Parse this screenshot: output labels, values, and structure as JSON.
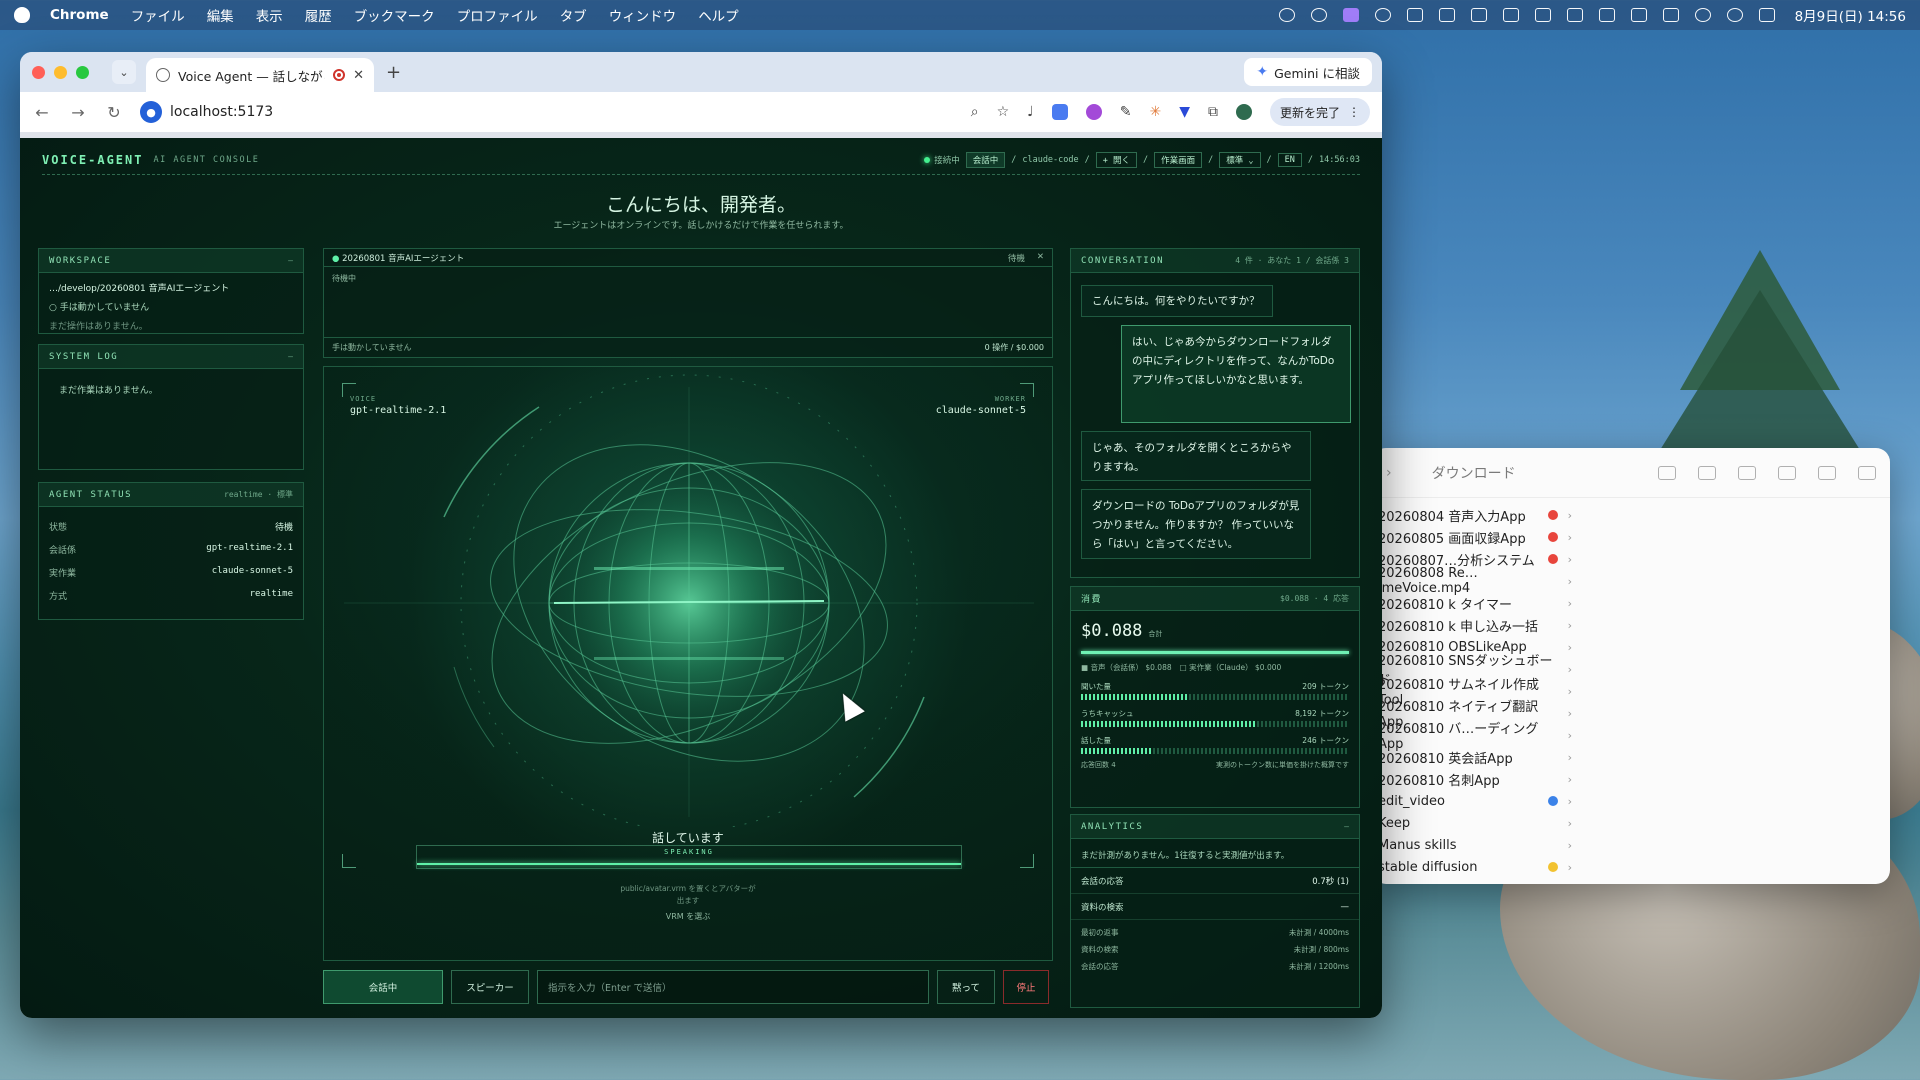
{
  "menubar": {
    "app": "Chrome",
    "items": [
      "ファイル",
      "編集",
      "表示",
      "履歴",
      "ブックマーク",
      "プロファイル",
      "タブ",
      "ウィンドウ",
      "ヘルプ"
    ],
    "clock": "8月9日(日) 14:56"
  },
  "browser": {
    "tab_title": "Voice Agent — 話しながら",
    "gemini_label": "Gemini に相談",
    "url": "localhost:5173",
    "update_label": "更新を完了"
  },
  "app": {
    "brand": "VOICE-AGENT",
    "brand_sub": "AI AGENT CONSOLE",
    "status": {
      "connected": "接続中",
      "in_conversation": "会話中",
      "engine": "claude-code",
      "open": "+ 開く",
      "work_screen": "作業画面",
      "mode": "標準",
      "lang": "EN",
      "time": "14:56:03"
    },
    "greeting": "こんにちは、開発者。",
    "greeting_sub": "エージェントはオンラインです。話しかけるだけで作業を任せられます。"
  },
  "workspace": {
    "title": "WORKSPACE",
    "path": "…/develop/20260801 音声AIエージェント",
    "hands": "手は動かしていません",
    "no_ops": "まだ操作はありません。"
  },
  "system_log": {
    "title": "SYSTEM LOG",
    "empty": "まだ作業はありません。"
  },
  "agent_status": {
    "title": "AGENT STATUS",
    "aux": "realtime · 標準",
    "rows": [
      {
        "k": "状態",
        "v": "待機"
      },
      {
        "k": "会話係",
        "v": "gpt-realtime-2.1"
      },
      {
        "k": "実作業",
        "v": "claude-sonnet-5"
      },
      {
        "k": "方式",
        "v": "realtime"
      }
    ]
  },
  "task": {
    "title": "20260801 音声AIエージェント",
    "state": "待機",
    "body": "待機中",
    "foot_left": "手は動かしていません",
    "foot_right": "0 操作 / $0.000"
  },
  "stage": {
    "voice_label": "VOICE",
    "voice_model": "gpt-realtime-2.1",
    "worker_label": "WORKER",
    "worker_model": "claude-sonnet-5",
    "speaking": "話しています",
    "speaking_tag": "SPEAKING",
    "hint_line1": "public/avatar.vrm を置くとアバターが",
    "hint_line2": "出ます",
    "vrm": "VRM を選ぶ"
  },
  "controls": {
    "talk": "会話中",
    "speaker": "スピーカー",
    "input_placeholder": "指示を入力（Enter で送信）",
    "silence": "黙って",
    "stop": "停止"
  },
  "conversation": {
    "title": "CONVERSATION",
    "aux": "4 件 · あなた 1 / 会話係 3",
    "messages": [
      {
        "role": "agent",
        "text": "こんにちは。何をやりたいですか？"
      },
      {
        "role": "user",
        "text": "はい、じゃあ今からダウンロードフォルダの中にディレクトリを作って、なんかToDoアプリ作ってほしいかなと思います。"
      },
      {
        "role": "agent",
        "text": "じゃあ、そのフォルダを開くところからやりますね。"
      },
      {
        "role": "agent",
        "text": "ダウンロードの ToDoアプリのフォルダが見つかりません。作りますか？ 作っていいなら「はい」と言ってください。"
      }
    ]
  },
  "cost": {
    "title": "消費",
    "aux": "$0.088 · 4 応答",
    "total": "$0.088",
    "total_label": "合計",
    "legend_voice": "音声（会話係） $0.088",
    "legend_worker": "実作業（Claude） $0.000",
    "tokens": [
      {
        "label": "聞いた量",
        "value": "209 トークン",
        "fill": 0.4
      },
      {
        "label": "うちキャッシュ",
        "value": "8,192 トークン",
        "fill": 0.65
      },
      {
        "label": "話した量",
        "value": "246 トークン",
        "fill": 0.27
      }
    ],
    "responses": "応答回数 4",
    "note": "実測のトークン数に単価を掛けた概算です"
  },
  "analytics": {
    "title": "ANALYTICS",
    "note": "まだ計測がありません。1往復すると実測値が出ます。",
    "rows": [
      {
        "k": "会話の応答",
        "v": "0.7秒  (1)"
      },
      {
        "k": "資料の検索",
        "v": "—"
      }
    ],
    "sub_rows": [
      {
        "k": "最初の返事",
        "v": "未計測 / 4000ms"
      },
      {
        "k": "資料の検索",
        "v": "未計測 / 800ms"
      },
      {
        "k": "会話の応答",
        "v": "未計測 / 1200ms"
      }
    ]
  },
  "finder": {
    "title": "ダウンロード",
    "items": [
      {
        "name": "20260804 音声入力App",
        "tag": "#e8453c"
      },
      {
        "name": "20260805 画面収録App",
        "tag": "#e8453c"
      },
      {
        "name": "20260807…分析システム",
        "tag": "#e8453c"
      },
      {
        "name": "20260808 Re…imeVoice.mp4",
        "tag": ""
      },
      {
        "name": "20260810 k タイマー",
        "tag": ""
      },
      {
        "name": "20260810 k 申し込み一括",
        "tag": ""
      },
      {
        "name": "20260810 OBSLikeApp",
        "tag": ""
      },
      {
        "name": "20260810 SNSダッシュボード",
        "tag": ""
      },
      {
        "name": "20260810 サムネイル作成Tool",
        "tag": ""
      },
      {
        "name": "20260810 ネイティブ翻訳App",
        "tag": ""
      },
      {
        "name": "20260810 バ…ーディングApp",
        "tag": ""
      },
      {
        "name": "20260810 英会話App",
        "tag": ""
      },
      {
        "name": "20260810 名刺App",
        "tag": ""
      },
      {
        "name": "edit_video",
        "tag": "#3b82e8"
      },
      {
        "name": "Keep",
        "tag": ""
      },
      {
        "name": "Manus skills",
        "tag": ""
      },
      {
        "name": "stable diffusion",
        "tag": "#f2c230"
      }
    ]
  }
}
